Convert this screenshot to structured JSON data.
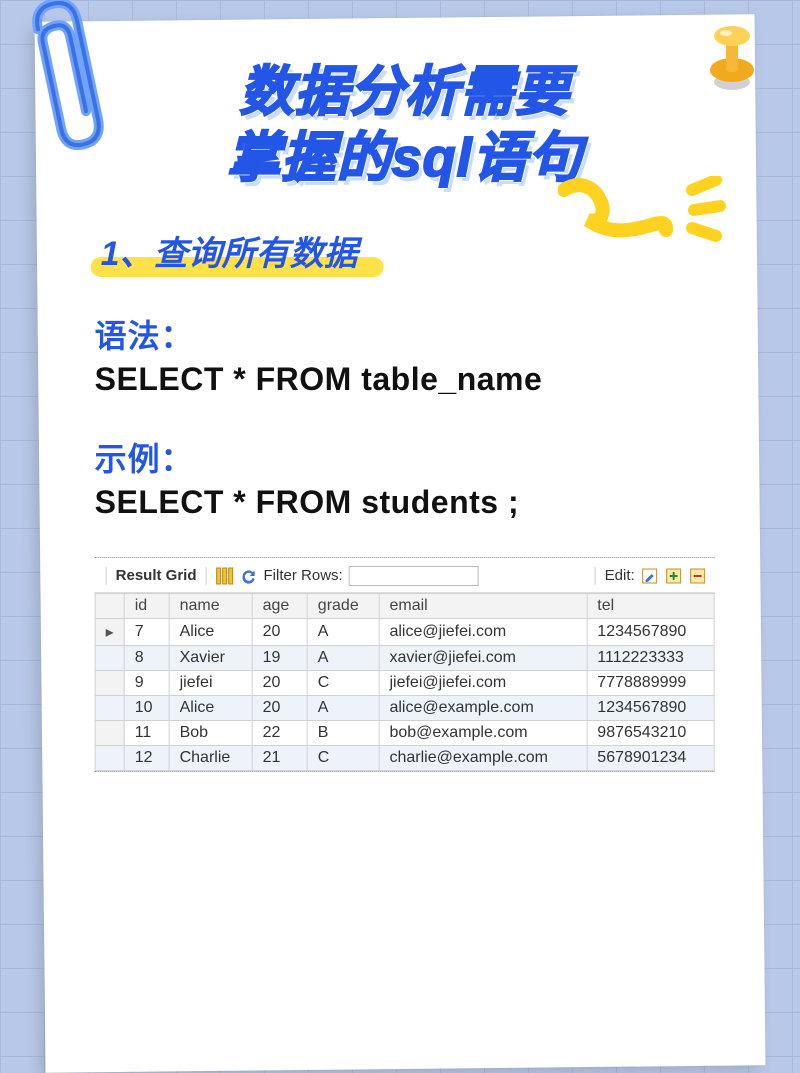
{
  "title_line1": "数据分析需要",
  "title_line2": "掌握的sql语句",
  "section": "1、查询所有数据",
  "syntax_label": "语法：",
  "syntax_code": "SELECT * FROM table_name",
  "example_label": "示例：",
  "example_code": "SELECT * FROM students ;",
  "grid": {
    "result_label": "Result Grid",
    "filter_label": "Filter Rows:",
    "filter_value": "",
    "edit_label": "Edit:",
    "columns": [
      "id",
      "name",
      "age",
      "grade",
      "email",
      "tel"
    ],
    "rows": [
      {
        "id": "7",
        "name": "Alice",
        "age": "20",
        "grade": "A",
        "email": "alice@jiefei.com",
        "tel": "1234567890",
        "cursor": true
      },
      {
        "id": "8",
        "name": "Xavier",
        "age": "19",
        "grade": "A",
        "email": "xavier@jiefei.com",
        "tel": "1112223333"
      },
      {
        "id": "9",
        "name": "jiefei",
        "age": "20",
        "grade": "C",
        "email": "jiefei@jiefei.com",
        "tel": "7778889999"
      },
      {
        "id": "10",
        "name": "Alice",
        "age": "20",
        "grade": "A",
        "email": "alice@example.com",
        "tel": "1234567890"
      },
      {
        "id": "11",
        "name": "Bob",
        "age": "22",
        "grade": "B",
        "email": "bob@example.com",
        "tel": "9876543210"
      },
      {
        "id": "12",
        "name": "Charlie",
        "age": "21",
        "grade": "C",
        "email": "charlie@example.com",
        "tel": "5678901234"
      }
    ]
  }
}
